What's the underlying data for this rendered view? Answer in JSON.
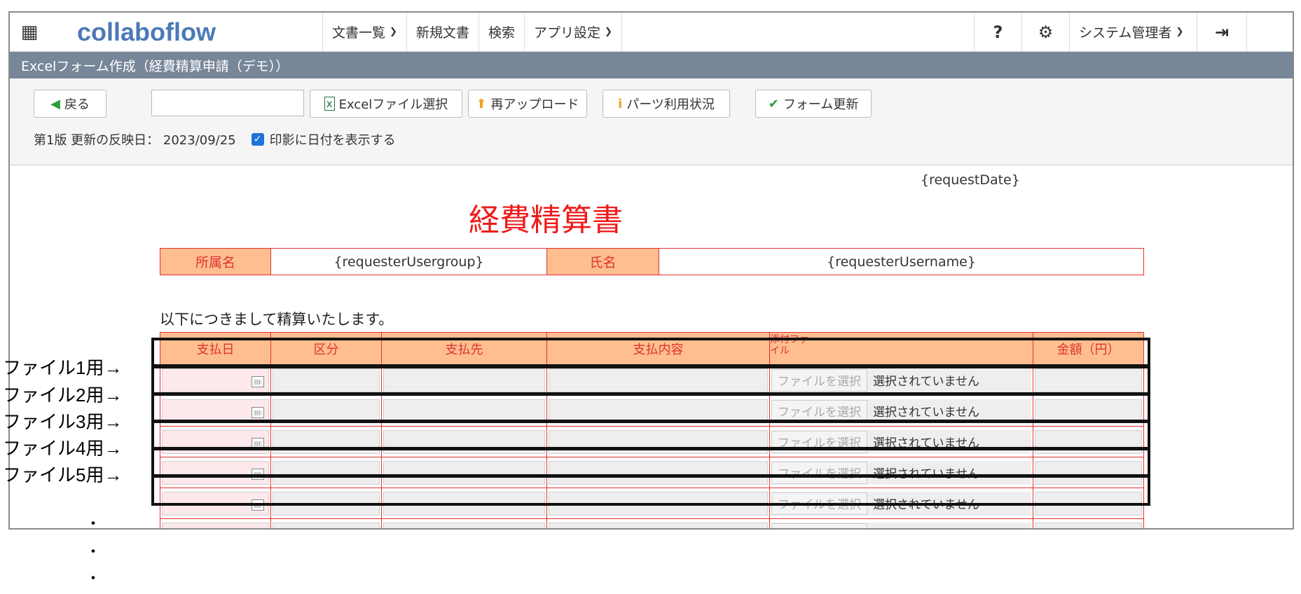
{
  "nav": {
    "logo": "collaboflow",
    "items": [
      {
        "label": "文書一覧",
        "dropdown": true
      },
      {
        "label": "新規文書",
        "dropdown": false
      },
      {
        "label": "検索",
        "dropdown": false
      },
      {
        "label": "アプリ設定",
        "dropdown": true
      }
    ],
    "help_icon": "question-icon",
    "settings_icon": "gear-icon",
    "user": "システム管理者",
    "logout_icon": "logout-icon"
  },
  "title_bar": "Excelフォーム作成（経費精算申請（デモ））",
  "toolbar": {
    "back": "戻る",
    "file_input_value": "",
    "select_excel": "Excelファイル選択",
    "reupload": "再アップロード",
    "parts_usage": "パーツ利用状況",
    "update_form": "フォーム更新",
    "version_info": "第1版 更新の反映日： 2023/09/25",
    "stamp_date_label": "印影に日付を表示する",
    "stamp_date_checked": true
  },
  "form": {
    "request_date": "{requestDate}",
    "title": "経費精算書",
    "info": {
      "group_label": "所属名",
      "group_value": "{requesterUsergroup}",
      "name_label": "氏名",
      "name_value": "{requesterUsername}"
    },
    "intro": "以下につきまして精算いたします。",
    "columns": [
      "支払日",
      "区分",
      "支払先",
      "支払内容",
      "添付ファイル",
      "金額（円）"
    ],
    "file_button": "ファイルを選択",
    "file_status": "選択されていません",
    "row_count": 6
  },
  "annotations": [
    "ファイル1用→",
    "ファイル2用→",
    "ファイル3用→",
    "ファイル4用→",
    "ファイル5用→"
  ],
  "colors": {
    "header_bg": "#ffbe8f",
    "border_red": "#e53030",
    "title_red": "#ee1b1b",
    "titlebar_bg": "#78869a"
  }
}
